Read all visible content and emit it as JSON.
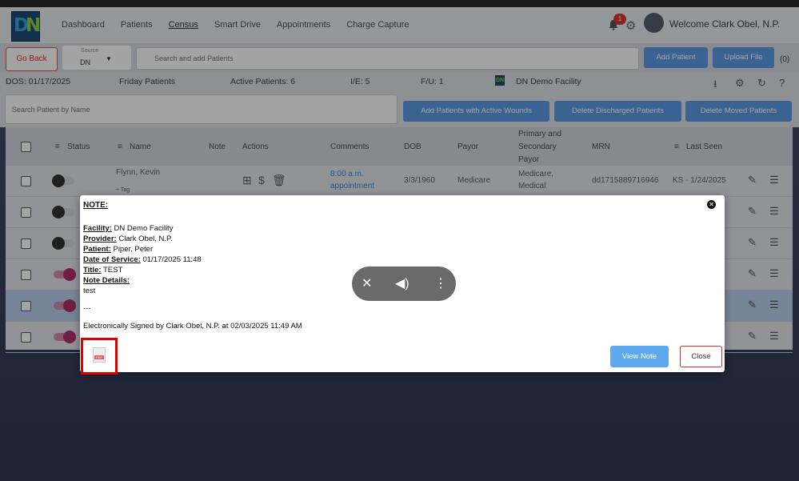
{
  "nav": {
    "logo": "DN",
    "links": [
      "Dashboard",
      "Patients",
      "Census",
      "Smart Drive",
      "Appointments",
      "Charge Capture"
    ],
    "notification_count": "1",
    "welcome": "Welcome Clark Obel, N.P."
  },
  "toolbar": {
    "go_back": "Go Back",
    "source_label": "Source",
    "source_value": "DN",
    "search_placeholder": "Search and add Patients",
    "add_patient": "Add Patient",
    "upload_file": "Upload File",
    "upload_count": "(0)"
  },
  "info": {
    "dos": "DOS: 01/17/2025",
    "census_name": "Friday Patients",
    "active_patients": "Active Patients: 6",
    "ie": "I/E: 5",
    "fu": "F/U: 1",
    "facility_logo": "DN",
    "facility": "DN Demo Facility"
  },
  "filters": {
    "search_name_placeholder": "Search Patient by Name",
    "add_active_wounds": "Add Patients with Active Wounds",
    "delete_discharged": "Delete Discharged Patients",
    "delete_moved": "Delete Moved Patients"
  },
  "table": {
    "headers": {
      "status": "Status",
      "name": "Name",
      "note": "Note",
      "actions": "Actions",
      "comments": "Comments",
      "dob": "DOB",
      "payor": "Payor",
      "primary_secondary": [
        "Primary and",
        "Secondary",
        "Payor"
      ],
      "mrn": "MRN",
      "last_seen": "Last Seen"
    },
    "first_row": {
      "name": "Flynn, Kevin",
      "tag": "+ Tag",
      "comment_line1": "8:00 a.m.",
      "comment_line2": "appointment",
      "dob": "3/3/1960",
      "payor": "Medicare",
      "primary_line1": "Medicare,",
      "primary_line2": "Medical",
      "mrn": "dd1715889716946",
      "last_seen": "KS - 1/24/2025"
    }
  },
  "modal": {
    "heading": "NOTE:",
    "facility_label": "Facility:",
    "facility_value": " DN Demo Facility",
    "provider_label": "Provider:",
    "provider_value": " Clark Obel, N.P.",
    "patient_label": "Patient:",
    "patient_value": " Piper, Peter",
    "dos_label": "Date of Service:",
    "dos_value": " 01/17/2025 11:48",
    "title_label": "Title:",
    "title_value": " TEST",
    "details_label": "Note Details:",
    "details_value": "test",
    "separator": "---",
    "signature": "Electronically Signed by Clark Obel, N.P. at 02/03/2025 11:49 AM",
    "pdf_tag": "PDF",
    "view_note": "View Note",
    "close": "Close"
  },
  "colors": {
    "accent_blue": "#5b9ce6",
    "danger_red": "#d33333",
    "toggle_on": "#b0306a",
    "highlight_frame": "#e00000"
  }
}
